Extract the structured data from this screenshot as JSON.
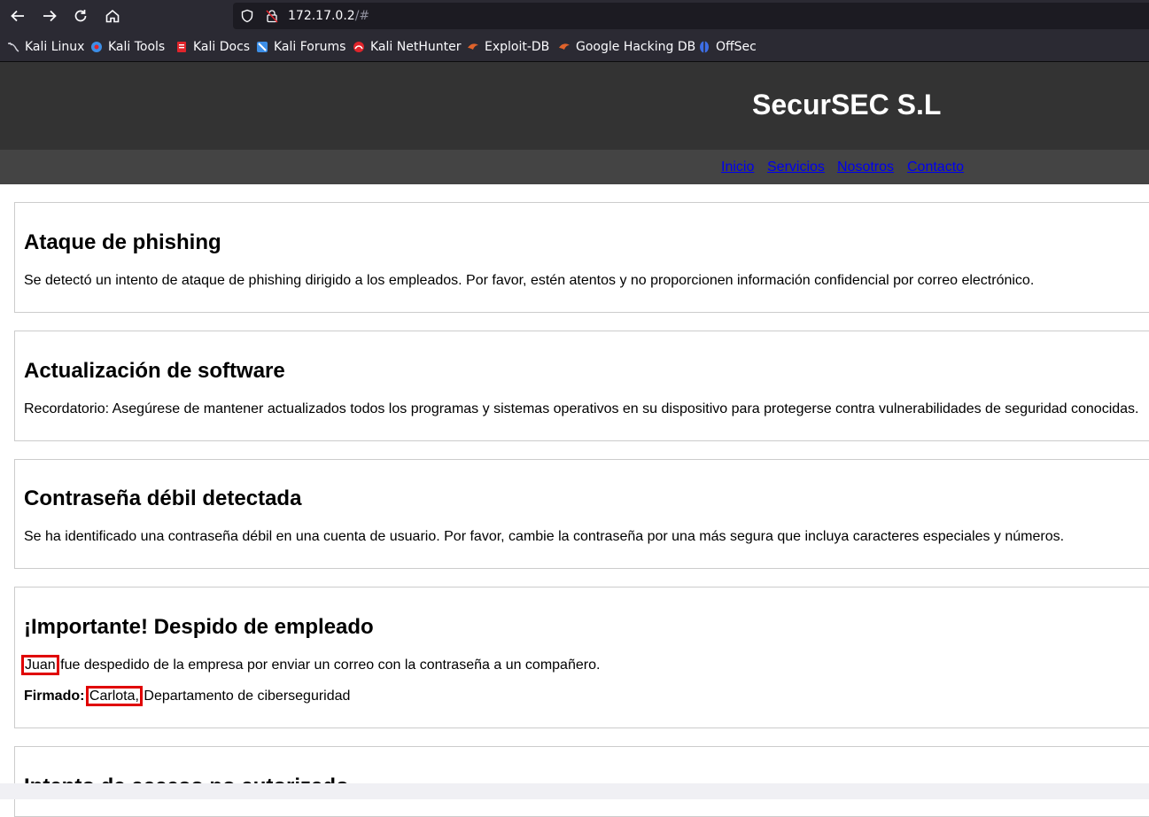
{
  "browser": {
    "url_host": "172.17.0.2",
    "url_path": "/#",
    "bookmarks": [
      {
        "label": "Kali Linux",
        "icon": "kali-dragon-icon",
        "color": "#cfcfd8"
      },
      {
        "label": "Kali Tools",
        "icon": "kali-tools-icon",
        "color": "#3d8ee6"
      },
      {
        "label": "Kali Docs",
        "icon": "kali-docs-icon",
        "color": "#e0242b"
      },
      {
        "label": "Kali Forums",
        "icon": "kali-forums-icon",
        "color": "#3d8ee6"
      },
      {
        "label": "Kali NetHunter",
        "icon": "kali-nethunter-icon",
        "color": "#e0242b"
      },
      {
        "label": "Exploit-DB",
        "icon": "exploit-db-icon",
        "color": "#e0632b"
      },
      {
        "label": "Google Hacking DB",
        "icon": "ghdb-icon",
        "color": "#e0632b"
      },
      {
        "label": "OffSec",
        "icon": "offsec-icon",
        "color": "#3d6ee6"
      }
    ]
  },
  "site": {
    "title": "SecurSEC S.L",
    "nav": [
      "Inicio",
      "Servicios",
      "Nosotros",
      "Contacto"
    ]
  },
  "articles": [
    {
      "title": "Ataque de phishing",
      "body": "Se detectó un intento de ataque de phishing dirigido a los empleados. Por favor, estén atentos y no proporcionen información confidencial por correo electrónico."
    },
    {
      "title": "Actualización de software",
      "body": "Recordatorio: Asegúrese de mantener actualizados todos los programas y sistemas operativos en su dispositivo para protegerse contra vulnerabilidades de seguridad conocidas."
    },
    {
      "title": "Contraseña débil detectada",
      "body": "Se ha identificado una contraseña débil en una cuenta de usuario. Por favor, cambie la contraseña por una más segura que incluya caracteres especiales y números."
    },
    {
      "title": "¡Importante! Despido de empleado",
      "name": "Juan",
      "body_rest": " fue despedido de la empresa por enviar un correo con la contraseña a un compañero.",
      "signed_label": "Firmado:",
      "signer": "Carlota,",
      "signer_dept": " Departamento de ciberseguridad"
    },
    {
      "title": "Intento de acceso no autorizado"
    }
  ],
  "colors": {
    "header_bg": "#333333",
    "nav_bg": "#444444",
    "link": "#0000ee",
    "highlight": "#e00000"
  }
}
